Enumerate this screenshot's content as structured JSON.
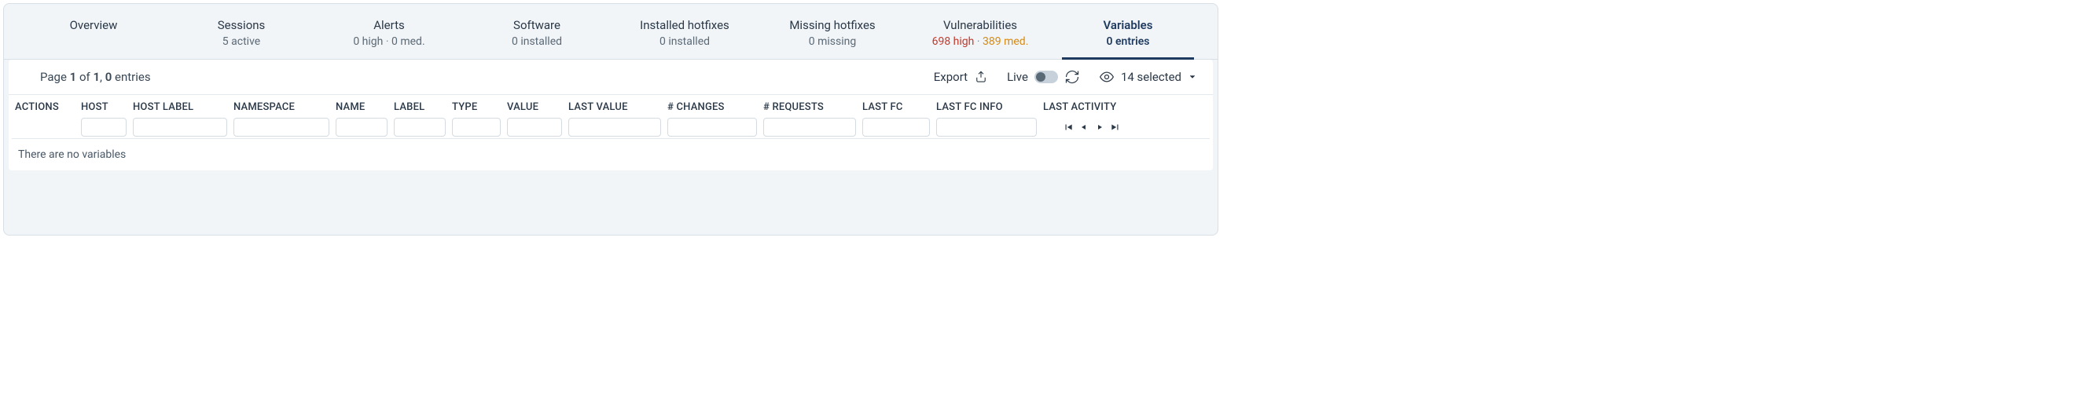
{
  "tabs": [
    {
      "label": "Overview",
      "sub": ""
    },
    {
      "label": "Sessions",
      "sub": "5 active"
    },
    {
      "label": "Alerts",
      "sub_high": "0 high",
      "sub_med": "0 med."
    },
    {
      "label": "Software",
      "sub": "0 installed"
    },
    {
      "label": "Installed hotfixes",
      "sub": "0 installed"
    },
    {
      "label": "Missing hotfixes",
      "sub": "0 missing"
    },
    {
      "label": "Vulnerabilities",
      "sub_high": "698 high",
      "sub_med": "389 med."
    },
    {
      "label": "Variables",
      "sub": "0 entries"
    }
  ],
  "toolbar": {
    "page_prefix": "Page ",
    "page_num": "1",
    "of": " of ",
    "page_total": "1",
    "comma": ", ",
    "entries_num": "0",
    "entries_suffix": " entries",
    "export": "Export",
    "live": "Live",
    "selected": "14 selected"
  },
  "columns": {
    "actions": "ACTIONS",
    "host": "HOST",
    "hostlabel": "HOST LABEL",
    "namespace": "NAMESPACE",
    "name": "NAME",
    "label": "LABEL",
    "type": "TYPE",
    "value": "VALUE",
    "lastvalue": "LAST VALUE",
    "changes": "# CHANGES",
    "requests": "# REQUESTS",
    "lastfc": "LAST FC",
    "lastfcinfo": "LAST FC INFO",
    "lastactivity": "LAST ACTIVITY"
  },
  "empty": "There are no variables"
}
